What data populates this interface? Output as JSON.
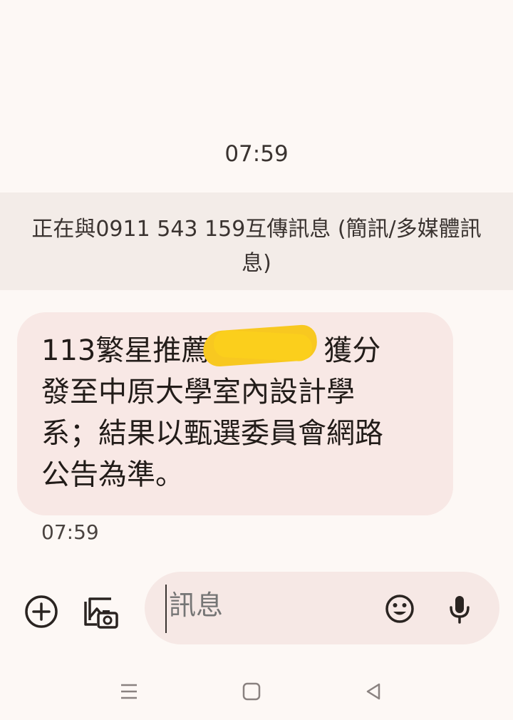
{
  "conversation": {
    "date_header": "07:59",
    "banner_text": "正在與0911 543 159互傳訊息 (簡訊/多媒體訊息)"
  },
  "messages": [
    {
      "text": "113繁星推薦　　　　獲分發至中原大學室內設計學系；結果以甄選委員會網路公告為準。",
      "time": "07:59"
    }
  ],
  "compose": {
    "placeholder": "訊息"
  },
  "icons": {
    "add": "add-circle-icon",
    "gallery": "gallery-icon",
    "emoji": "emoji-icon",
    "mic": "mic-icon",
    "recents": "menu-icon",
    "home": "square-icon",
    "back": "triangle-back-icon"
  },
  "colors": {
    "background": "#fdf8f5",
    "banner": "#f3ece8",
    "bubble": "#f8e8e5",
    "redaction": "#f8c820"
  }
}
